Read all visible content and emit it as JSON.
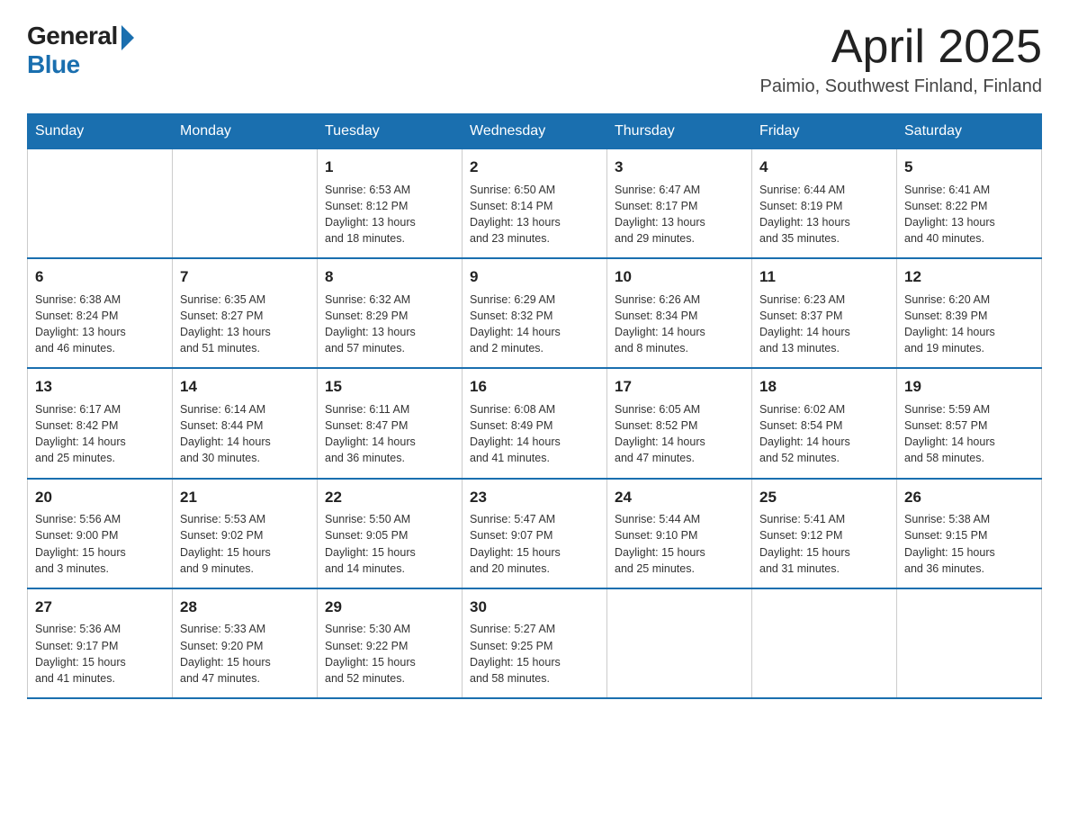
{
  "header": {
    "logo_general": "General",
    "logo_blue": "Blue",
    "month": "April 2025",
    "location": "Paimio, Southwest Finland, Finland"
  },
  "days_of_week": [
    "Sunday",
    "Monday",
    "Tuesday",
    "Wednesday",
    "Thursday",
    "Friday",
    "Saturday"
  ],
  "weeks": [
    [
      {
        "num": "",
        "info": ""
      },
      {
        "num": "",
        "info": ""
      },
      {
        "num": "1",
        "info": "Sunrise: 6:53 AM\nSunset: 8:12 PM\nDaylight: 13 hours\nand 18 minutes."
      },
      {
        "num": "2",
        "info": "Sunrise: 6:50 AM\nSunset: 8:14 PM\nDaylight: 13 hours\nand 23 minutes."
      },
      {
        "num": "3",
        "info": "Sunrise: 6:47 AM\nSunset: 8:17 PM\nDaylight: 13 hours\nand 29 minutes."
      },
      {
        "num": "4",
        "info": "Sunrise: 6:44 AM\nSunset: 8:19 PM\nDaylight: 13 hours\nand 35 minutes."
      },
      {
        "num": "5",
        "info": "Sunrise: 6:41 AM\nSunset: 8:22 PM\nDaylight: 13 hours\nand 40 minutes."
      }
    ],
    [
      {
        "num": "6",
        "info": "Sunrise: 6:38 AM\nSunset: 8:24 PM\nDaylight: 13 hours\nand 46 minutes."
      },
      {
        "num": "7",
        "info": "Sunrise: 6:35 AM\nSunset: 8:27 PM\nDaylight: 13 hours\nand 51 minutes."
      },
      {
        "num": "8",
        "info": "Sunrise: 6:32 AM\nSunset: 8:29 PM\nDaylight: 13 hours\nand 57 minutes."
      },
      {
        "num": "9",
        "info": "Sunrise: 6:29 AM\nSunset: 8:32 PM\nDaylight: 14 hours\nand 2 minutes."
      },
      {
        "num": "10",
        "info": "Sunrise: 6:26 AM\nSunset: 8:34 PM\nDaylight: 14 hours\nand 8 minutes."
      },
      {
        "num": "11",
        "info": "Sunrise: 6:23 AM\nSunset: 8:37 PM\nDaylight: 14 hours\nand 13 minutes."
      },
      {
        "num": "12",
        "info": "Sunrise: 6:20 AM\nSunset: 8:39 PM\nDaylight: 14 hours\nand 19 minutes."
      }
    ],
    [
      {
        "num": "13",
        "info": "Sunrise: 6:17 AM\nSunset: 8:42 PM\nDaylight: 14 hours\nand 25 minutes."
      },
      {
        "num": "14",
        "info": "Sunrise: 6:14 AM\nSunset: 8:44 PM\nDaylight: 14 hours\nand 30 minutes."
      },
      {
        "num": "15",
        "info": "Sunrise: 6:11 AM\nSunset: 8:47 PM\nDaylight: 14 hours\nand 36 minutes."
      },
      {
        "num": "16",
        "info": "Sunrise: 6:08 AM\nSunset: 8:49 PM\nDaylight: 14 hours\nand 41 minutes."
      },
      {
        "num": "17",
        "info": "Sunrise: 6:05 AM\nSunset: 8:52 PM\nDaylight: 14 hours\nand 47 minutes."
      },
      {
        "num": "18",
        "info": "Sunrise: 6:02 AM\nSunset: 8:54 PM\nDaylight: 14 hours\nand 52 minutes."
      },
      {
        "num": "19",
        "info": "Sunrise: 5:59 AM\nSunset: 8:57 PM\nDaylight: 14 hours\nand 58 minutes."
      }
    ],
    [
      {
        "num": "20",
        "info": "Sunrise: 5:56 AM\nSunset: 9:00 PM\nDaylight: 15 hours\nand 3 minutes."
      },
      {
        "num": "21",
        "info": "Sunrise: 5:53 AM\nSunset: 9:02 PM\nDaylight: 15 hours\nand 9 minutes."
      },
      {
        "num": "22",
        "info": "Sunrise: 5:50 AM\nSunset: 9:05 PM\nDaylight: 15 hours\nand 14 minutes."
      },
      {
        "num": "23",
        "info": "Sunrise: 5:47 AM\nSunset: 9:07 PM\nDaylight: 15 hours\nand 20 minutes."
      },
      {
        "num": "24",
        "info": "Sunrise: 5:44 AM\nSunset: 9:10 PM\nDaylight: 15 hours\nand 25 minutes."
      },
      {
        "num": "25",
        "info": "Sunrise: 5:41 AM\nSunset: 9:12 PM\nDaylight: 15 hours\nand 31 minutes."
      },
      {
        "num": "26",
        "info": "Sunrise: 5:38 AM\nSunset: 9:15 PM\nDaylight: 15 hours\nand 36 minutes."
      }
    ],
    [
      {
        "num": "27",
        "info": "Sunrise: 5:36 AM\nSunset: 9:17 PM\nDaylight: 15 hours\nand 41 minutes."
      },
      {
        "num": "28",
        "info": "Sunrise: 5:33 AM\nSunset: 9:20 PM\nDaylight: 15 hours\nand 47 minutes."
      },
      {
        "num": "29",
        "info": "Sunrise: 5:30 AM\nSunset: 9:22 PM\nDaylight: 15 hours\nand 52 minutes."
      },
      {
        "num": "30",
        "info": "Sunrise: 5:27 AM\nSunset: 9:25 PM\nDaylight: 15 hours\nand 58 minutes."
      },
      {
        "num": "",
        "info": ""
      },
      {
        "num": "",
        "info": ""
      },
      {
        "num": "",
        "info": ""
      }
    ]
  ]
}
